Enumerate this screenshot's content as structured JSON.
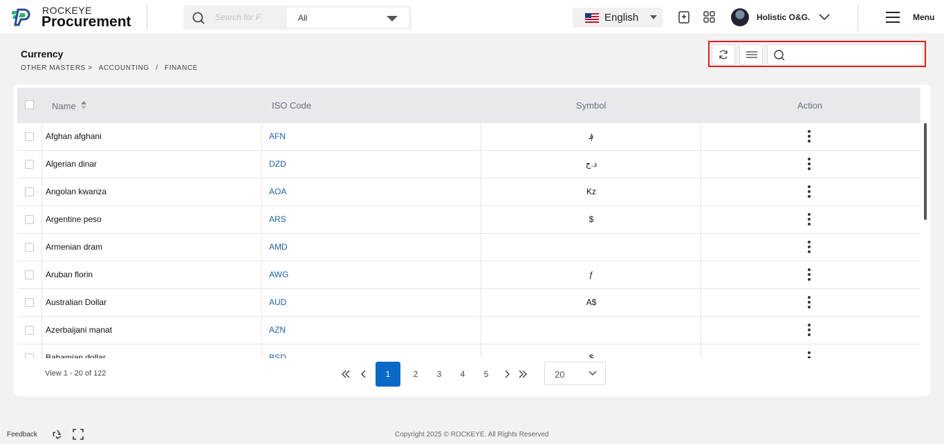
{
  "header": {
    "brand_top": "ROCKEYE",
    "brand_main": "Procurement",
    "search_placeholder": "Search for F",
    "scope_value": "All",
    "language": "English",
    "user_name": "Holistic O&G.",
    "menu_label": "Menu"
  },
  "page": {
    "title": "Currency",
    "breadcrumb": [
      "OTHER MASTERS >",
      "ACCOUNTING",
      "/",
      "FINANCE"
    ]
  },
  "table": {
    "columns": [
      "Name",
      "ISO Code",
      "Symbol",
      "Action"
    ],
    "rows": [
      {
        "name": "Afghan afghani",
        "iso": "AFN",
        "symbol": "؋"
      },
      {
        "name": "Algerian dinar",
        "iso": "DZD",
        "symbol": "د.ج"
      },
      {
        "name": "Angolan kwanza",
        "iso": "AOA",
        "symbol": "Kz"
      },
      {
        "name": "Argentine peso",
        "iso": "ARS",
        "symbol": "$"
      },
      {
        "name": "Armenian dram",
        "iso": "AMD",
        "symbol": ""
      },
      {
        "name": "Aruban florin",
        "iso": "AWG",
        "symbol": "ƒ"
      },
      {
        "name": "Australian Dollar",
        "iso": "AUD",
        "symbol": "A$"
      },
      {
        "name": "Azerbaijani manat",
        "iso": "AZN",
        "symbol": ""
      },
      {
        "name": "Bahamian dollar",
        "iso": "BSD",
        "symbol": "$"
      }
    ]
  },
  "pagination": {
    "view_text": "View 1 - 20 of 122",
    "pages": [
      "1",
      "2",
      "3",
      "4",
      "5"
    ],
    "active_page": "1",
    "page_size": "20"
  },
  "footer": {
    "feedback": "Feedback",
    "copyright": "Copyright 2025 © ROCKEYE. All Rights Reserved"
  },
  "colors": {
    "accent": "#0b69c7",
    "highlight_border": "#e21b1b",
    "iso_link": "#1d5fa8"
  }
}
